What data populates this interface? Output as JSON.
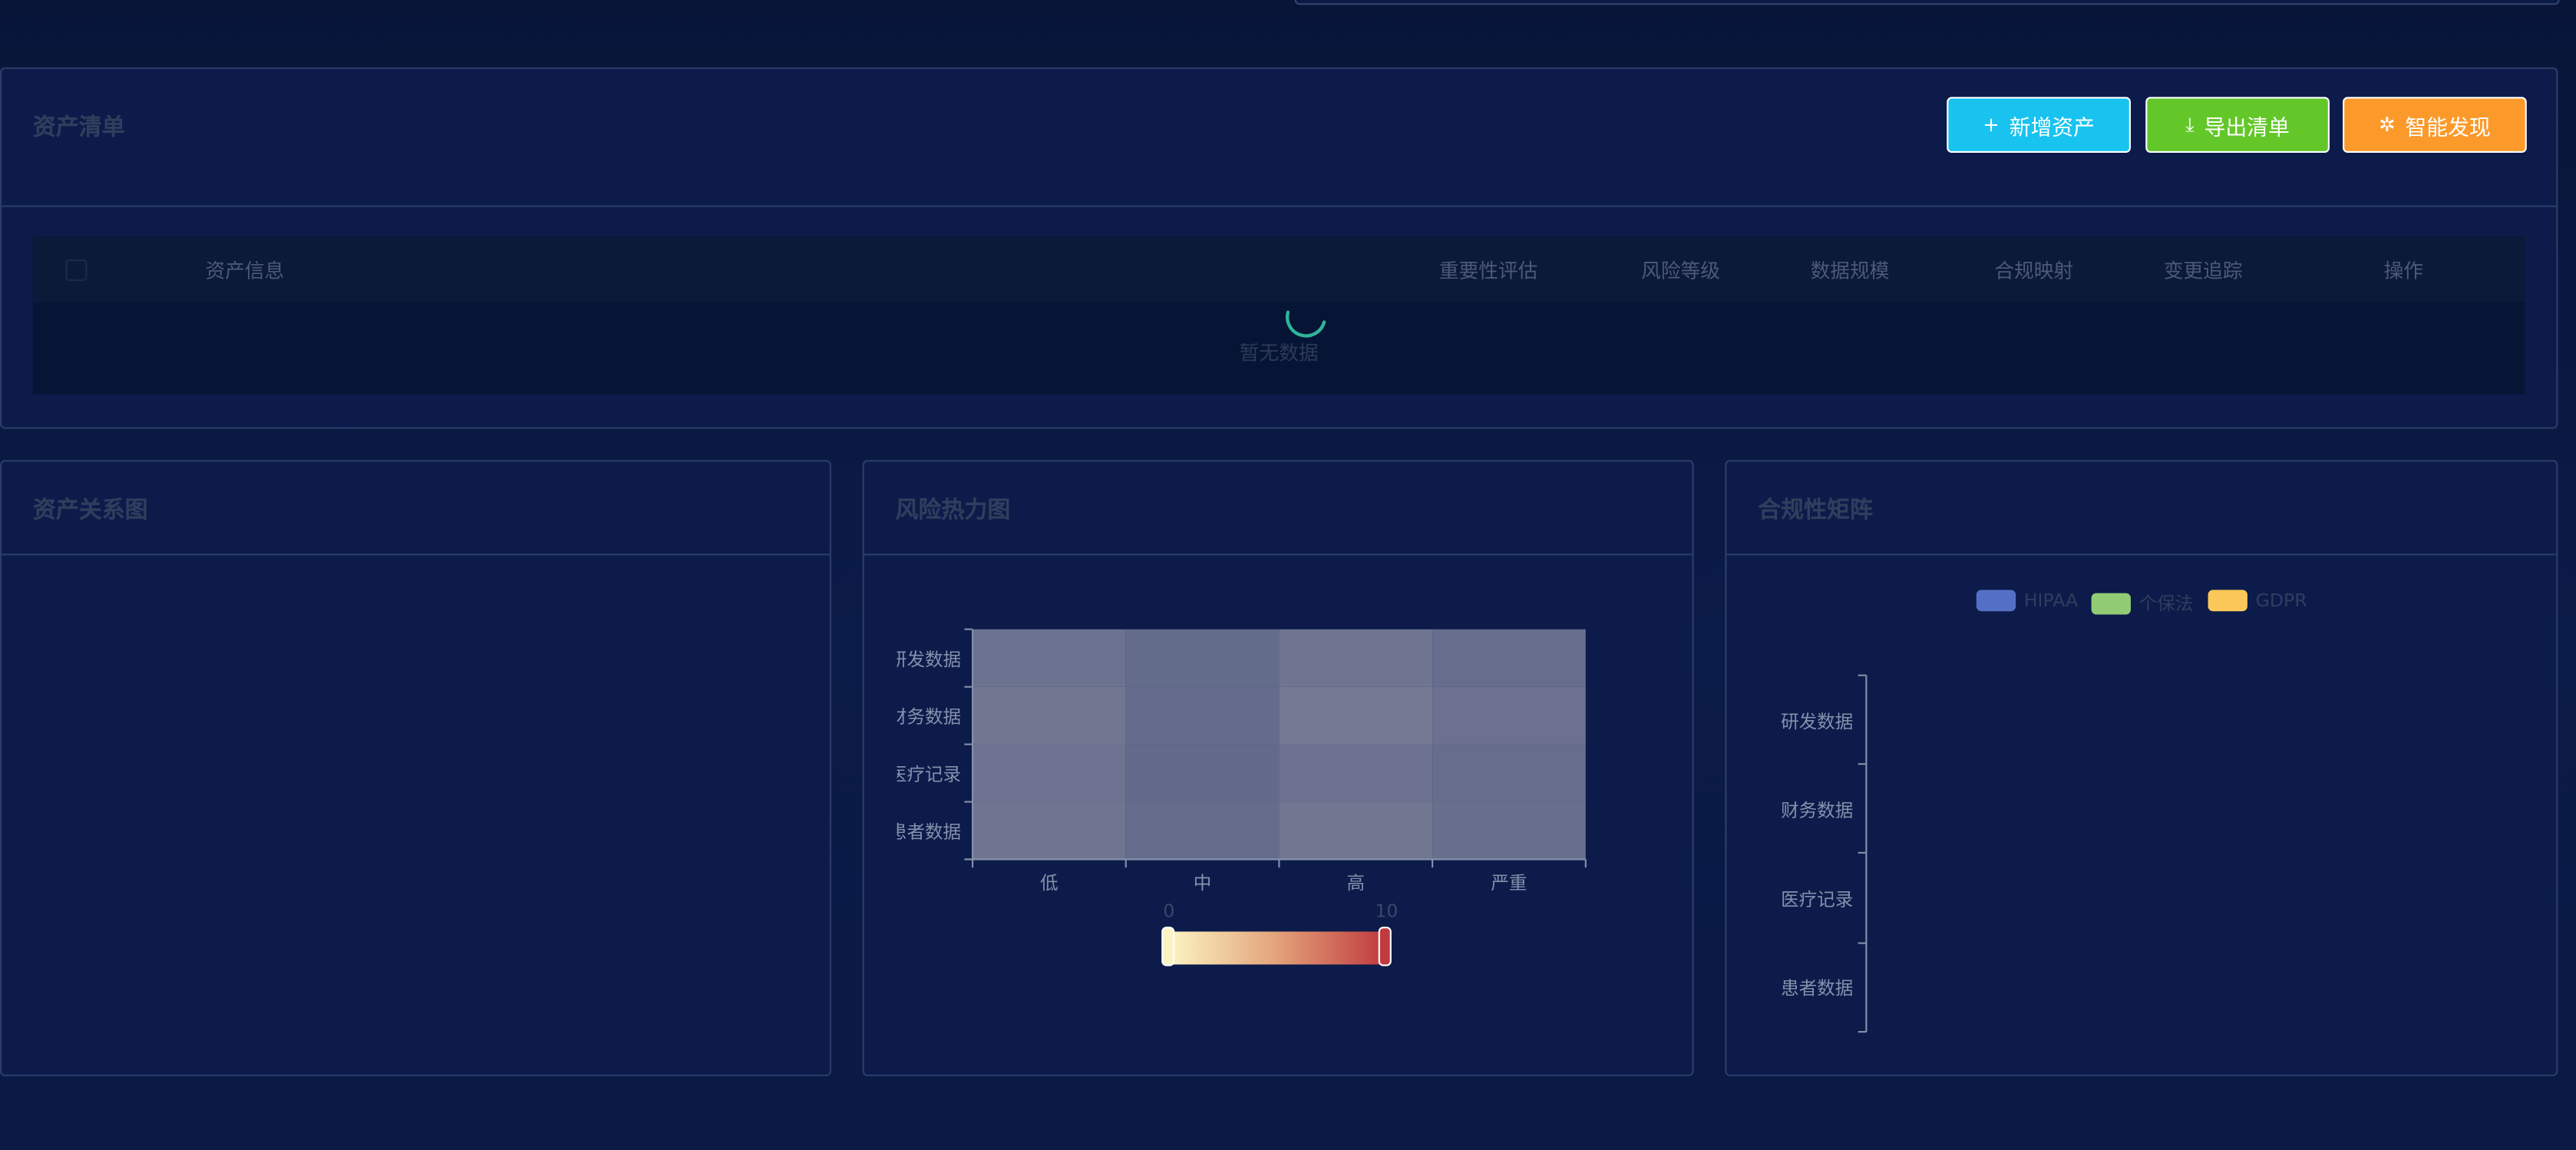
{
  "asset_list": {
    "title": "资产清单",
    "buttons": {
      "add": {
        "label": "新增资产",
        "icon": "plus-icon",
        "color": "#18c3ef"
      },
      "export": {
        "label": "导出清单",
        "icon": "download-icon",
        "color": "#63c72a"
      },
      "discover": {
        "label": "智能发现",
        "icon": "sparkle-icon",
        "color": "#fb9a2b"
      }
    },
    "table": {
      "columns": [
        "资产信息",
        "重要性评估",
        "风险等级",
        "数据规模",
        "合规映射",
        "变更追踪",
        "操作"
      ],
      "empty_text": "暂无数据"
    }
  },
  "relation_graph": {
    "title": "资产关系图"
  },
  "heatmap": {
    "title": "风险热力图",
    "x_labels": [
      "低",
      "中",
      "高",
      "严重"
    ],
    "y_labels": [
      "研发数据",
      "财务数据",
      "医疗记录",
      "患者数据"
    ],
    "visual_map": {
      "min": "0",
      "max": "10",
      "low_color": "#fbf4c2",
      "high_color": "#c03a3e"
    },
    "cell_colors": [
      [
        "#6c7391",
        "#646c8c",
        "#6f7591",
        "#676e8d"
      ],
      [
        "#717791",
        "#646b8c",
        "#747892",
        "#6b718f"
      ],
      [
        "#6d7390",
        "#636a8b",
        "#6c7290",
        "#666d8d"
      ],
      [
        "#6f7590",
        "#656c8c",
        "#717691",
        "#686f8d"
      ]
    ]
  },
  "chart_data": {
    "type": "bar",
    "title": "合规性矩阵",
    "categories": [
      "研发数据",
      "财务数据",
      "医疗记录",
      "患者数据"
    ],
    "series": [
      {
        "name": "HIPAA",
        "values": [],
        "color": "#5470c6"
      },
      {
        "name": "个保法",
        "values": [],
        "color": "#91cc75"
      },
      {
        "name": "GDPR",
        "values": [],
        "color": "#fac858"
      }
    ],
    "legend": "top-center",
    "orientation": "horizontal"
  }
}
